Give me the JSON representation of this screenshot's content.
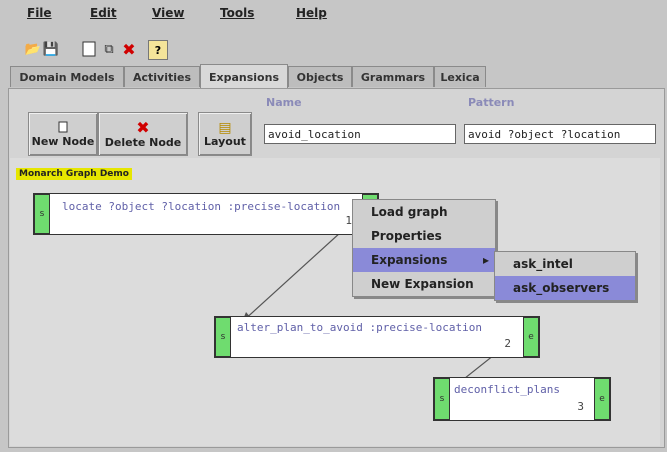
{
  "menubar": {
    "items": [
      {
        "label": "File"
      },
      {
        "label": "Edit"
      },
      {
        "label": "View"
      },
      {
        "label": "Tools"
      },
      {
        "label": "Help"
      }
    ]
  },
  "toolbar": {
    "icons": [
      "open-folder-icon",
      "save-icon",
      "new-doc-icon",
      "copy-icon",
      "delete-icon",
      "help-icon"
    ]
  },
  "tabs": [
    {
      "label": "Domain Models"
    },
    {
      "label": "Activities"
    },
    {
      "label": "Expansions",
      "active": true
    },
    {
      "label": "Objects"
    },
    {
      "label": "Grammars"
    },
    {
      "label": "Lexica"
    }
  ],
  "editor": {
    "new_node_label": "New Node",
    "delete_node_label": "Delete Node",
    "layout_label": "Layout",
    "name_header": "Name",
    "pattern_header": "Pattern",
    "name_value": "avoid_location",
    "pattern_value": "avoid ?object ?location"
  },
  "graph": {
    "title": "Monarch Graph Demo",
    "nodes": [
      {
        "label": "locate ?object ?location :precise-location",
        "num": "1",
        "left_port": "s",
        "right_port": "e"
      },
      {
        "label": "alter_plan_to_avoid :precise-location",
        "num": "2",
        "left_port": "s",
        "right_port": "e"
      },
      {
        "label": "deconflict_plans",
        "num": "3",
        "left_port": "s",
        "right_port": "e"
      }
    ]
  },
  "context_menu": {
    "items": [
      {
        "label": "Load graph"
      },
      {
        "label": "Properties"
      },
      {
        "label": "Expansions",
        "submenu_arrow": "▸"
      },
      {
        "label": "New Expansion"
      }
    ],
    "submenu": [
      {
        "label": "ask_intel"
      },
      {
        "label": "ask_observers"
      }
    ]
  }
}
